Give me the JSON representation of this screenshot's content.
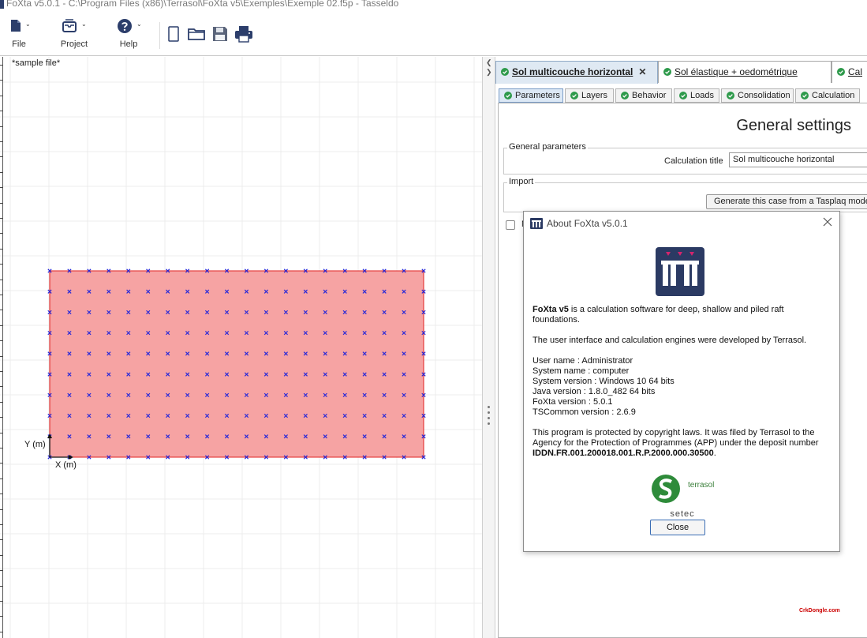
{
  "window": {
    "title": "FoXta v5.0.1 - C:\\Program Files (x86)\\Terrasol\\FoXta v5\\Exemples\\Exemple 02.f5p - Tasseldo"
  },
  "toolbar": {
    "file_label": "File",
    "project_label": "Project",
    "help_label": "Help",
    "caret": "⌄"
  },
  "canvas": {
    "file_label": "*sample file*",
    "y_axis_label": "Y (m)",
    "x_axis_label": "X (m)",
    "mesh_columns": 20,
    "mesh_rows": 10,
    "fill_color": "#f6a3a3",
    "border_color": "#e02020",
    "point_color": "#2a2ad8"
  },
  "splitter": {
    "arrow_left": "❮",
    "arrow_right": "❯"
  },
  "doc_tabs": [
    {
      "label": "Sol multicouche horizontal",
      "active": true,
      "close": "✕"
    },
    {
      "label": "Sol élastique + oedométrique",
      "active": false
    },
    {
      "label": "Cal",
      "active": false
    }
  ],
  "sub_tabs": [
    {
      "label": "Parameters",
      "active": true
    },
    {
      "label": "Layers",
      "active": false
    },
    {
      "label": "Behavior",
      "active": false
    },
    {
      "label": "Loads",
      "active": false
    },
    {
      "label": "Consolidation",
      "active": false
    },
    {
      "label": "Calculation",
      "active": false
    }
  ],
  "settings": {
    "section_title": "General settings",
    "general_legend": "General parameters",
    "calc_title_label": "Calculation title",
    "calc_title_value": "Sol multicouche horizontal",
    "import_legend": "Import",
    "generate_button": "Generate this case from a Tasplaq model",
    "checkbox_label": "M"
  },
  "about": {
    "title": "About FoXta v5.0.1",
    "intro_bold": "FoXta v5",
    "intro_rest": " is a calculation software for deep, shallow and piled raft foundations.",
    "developed": "The user interface and calculation engines were developed by Terrasol.",
    "user_name": "User name : Administrator",
    "system_name": "System name : computer",
    "system_version": "System version : Windows 10 64 bits",
    "java_version": "Java version : 1.8.0_482 64 bits",
    "foxta_version": "FoXta version : 5.0.1",
    "tscommon_version": "TSCommon version : 2.6.9",
    "protected": "This program is protected by copyright laws. It was filed by Terrasol to the Agency for the Protection of Programmes (APP) under the deposit number ",
    "deposit_number": "IDDN.FR.001.200018.001.R.P.2000.000.30500",
    "deposit_end": ".",
    "terrasol_text": "terrasol",
    "setec_text": "setec",
    "close_button": "Close"
  },
  "watermark": "CrkDongle.com",
  "colors": {
    "tab_check": "#2e9a4b",
    "logo_bg": "#2b3a63",
    "logo_pin": "#d6246e",
    "terrasol_green": "#2e8b3a"
  }
}
